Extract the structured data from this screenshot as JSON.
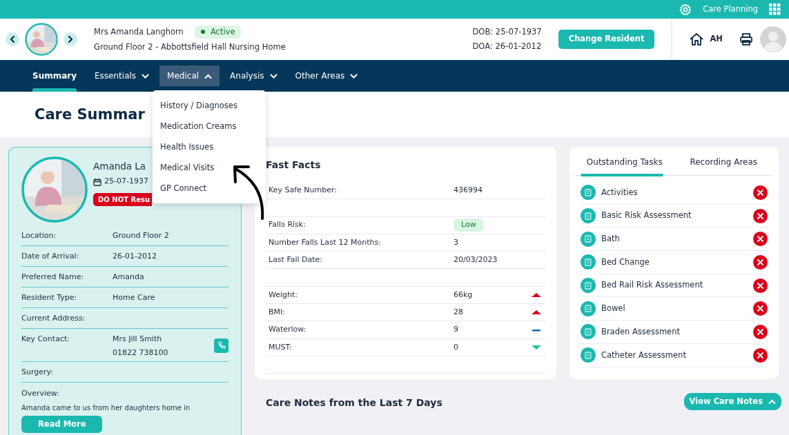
{
  "top_bar": {
    "app_label": "Care Planning"
  },
  "resident_header": {
    "name": "Mrs Amanda Langhorn",
    "status": "Active",
    "location": "Ground Floor 2 - Abbottsfield Hall Nursing Home",
    "dob": "DOB: 25-07-1937",
    "doa": "DOA: 26-01-2012",
    "change_button": "Change Resident",
    "user_initials": "AH"
  },
  "nav": [
    {
      "label": "Summary",
      "selected": true,
      "dropdown": false,
      "expanded": false
    },
    {
      "label": "Essentials",
      "selected": false,
      "dropdown": true,
      "expanded": false
    },
    {
      "label": "Medical",
      "selected": false,
      "dropdown": true,
      "expanded": true
    },
    {
      "label": "Analysis",
      "selected": false,
      "dropdown": true,
      "expanded": false
    },
    {
      "label": "Other Areas",
      "selected": false,
      "dropdown": true,
      "expanded": false
    }
  ],
  "medical_menu": [
    "History / Diagnoses",
    "Medication Creams",
    "Health Issues",
    "Medical Visits",
    "GP Connect"
  ],
  "page_title": "Care Summar",
  "profile_card": {
    "name": "Amanda La",
    "dob": "25-07-1937",
    "alert": "DO NOT Resu",
    "fields": [
      {
        "label": "Location:",
        "lines": [
          "Ground Floor 2"
        ],
        "kind": "text"
      },
      {
        "label": "Date of Arrival:",
        "lines": [
          "26-01-2012"
        ],
        "kind": "text"
      },
      {
        "label": "Preferred Name:",
        "lines": [
          "Amanda"
        ],
        "kind": "text"
      },
      {
        "label": "Resident Type:",
        "lines": [
          "Home Care"
        ],
        "kind": "text"
      },
      {
        "label": "Current Address:",
        "kind": "text"
      },
      {
        "label": "Key Contact:",
        "lines": [
          "Mrs Jill Smith",
          "01822 738100"
        ],
        "kind": "contact"
      },
      {
        "label": "Surgery:",
        "kind": "text"
      }
    ],
    "overview_label": "Overview:",
    "overview_text": "Amanda came to us from her daughters home in",
    "read_more": "Read More"
  },
  "fast_facts": {
    "title": "Fast Facts",
    "rows": [
      {
        "kind": "fact",
        "label": "Key Safe Number:",
        "value": "436994"
      },
      {
        "kind": "blank"
      },
      {
        "kind": "badge",
        "label": "Falls Risk:",
        "value": "Low"
      },
      {
        "kind": "fact",
        "label": "Number Falls Last 12 Months:",
        "value": "3"
      },
      {
        "kind": "fact",
        "label": "Last Fall Date:",
        "value": "20/03/2023"
      },
      {
        "kind": "blank"
      },
      {
        "kind": "rising",
        "label": "Weight:",
        "value": "66kg"
      },
      {
        "kind": "rising",
        "label": "BMI:",
        "value": "28"
      },
      {
        "kind": "steady",
        "label": "Waterlow:",
        "value": "9"
      },
      {
        "kind": "falling",
        "label": "MUST:",
        "value": "0"
      },
      {
        "kind": "blank"
      }
    ]
  },
  "tasks_card": {
    "tabs": [
      {
        "label": "Outstanding Tasks",
        "selected": true
      },
      {
        "label": "Recording Areas",
        "selected": false
      }
    ],
    "tasks": [
      "Activities",
      "Basic Risk Assessment",
      "Bath",
      "Bed Change",
      "Bed Rail Risk Assessment",
      "Bowel",
      "Braden Assessment",
      "Catheter Assessment"
    ]
  },
  "care_notes": {
    "title": "Care Notes from the Last 7 Days",
    "button": "View Care Notes"
  }
}
